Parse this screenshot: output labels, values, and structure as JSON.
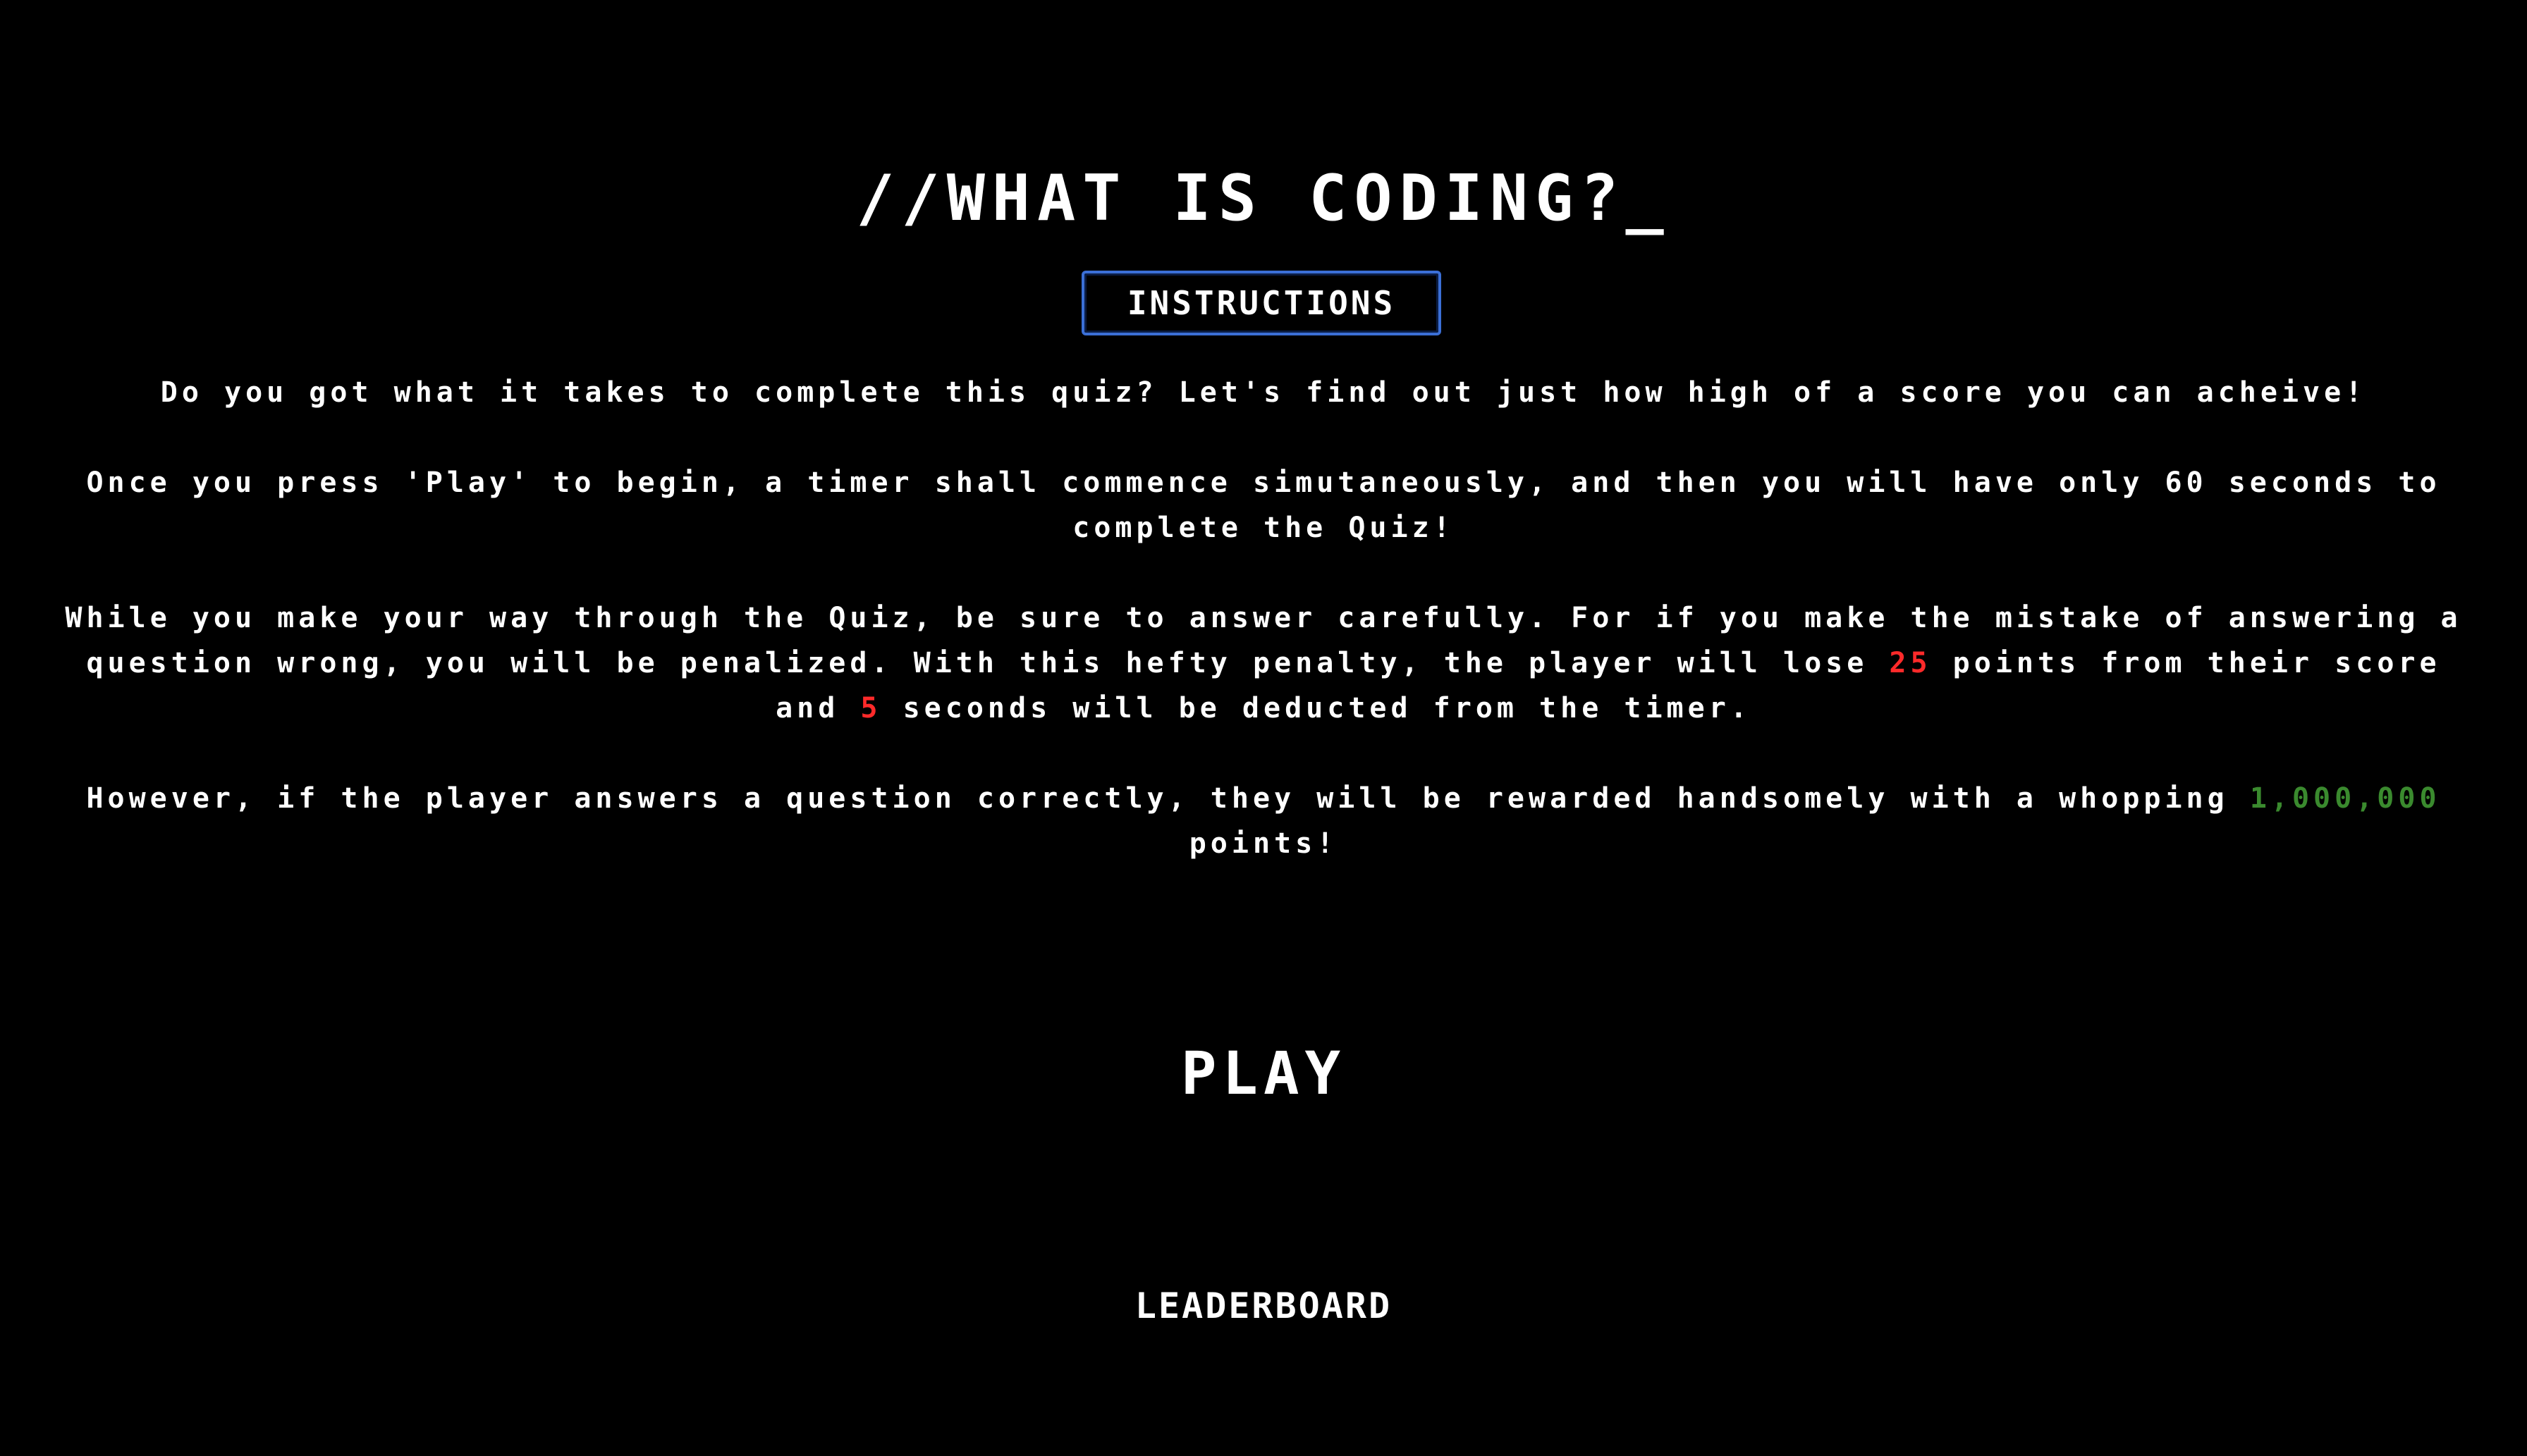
{
  "header": {
    "title": "//WHAT IS CODING?_"
  },
  "instructions_button": {
    "label": "INSTRUCTIONS"
  },
  "instructions": {
    "p1": "Do you got what it takes to complete this quiz? Let's find out just how high of a score you can acheive!",
    "p2": "Once you press 'Play' to begin, a timer shall commence simutaneously, and then you will have only 60 seconds to complete the Quiz!",
    "p3_a": "While you make your way through the Quiz, be sure to answer carefully. For if you make the mistake of answering a question wrong, you will be penalized. With this hefty penalty, the player will lose ",
    "p3_points": "25",
    "p3_b": " points from their score and ",
    "p3_seconds": "5",
    "p3_c": " seconds will be deducted from the timer.",
    "p4_a": "However, if the player answers a question correctly, they will be rewarded handsomely with a whopping ",
    "p4_points": "1,000,000",
    "p4_b": " points!"
  },
  "actions": {
    "play_label": "PLAY",
    "leaderboard_label": "LEADERBOARD"
  },
  "colors": {
    "background": "#000000",
    "text": "#ffffff",
    "penalty": "#ff2a2a",
    "reward": "#3a8a2e",
    "button_border": "#3b6fd6"
  }
}
